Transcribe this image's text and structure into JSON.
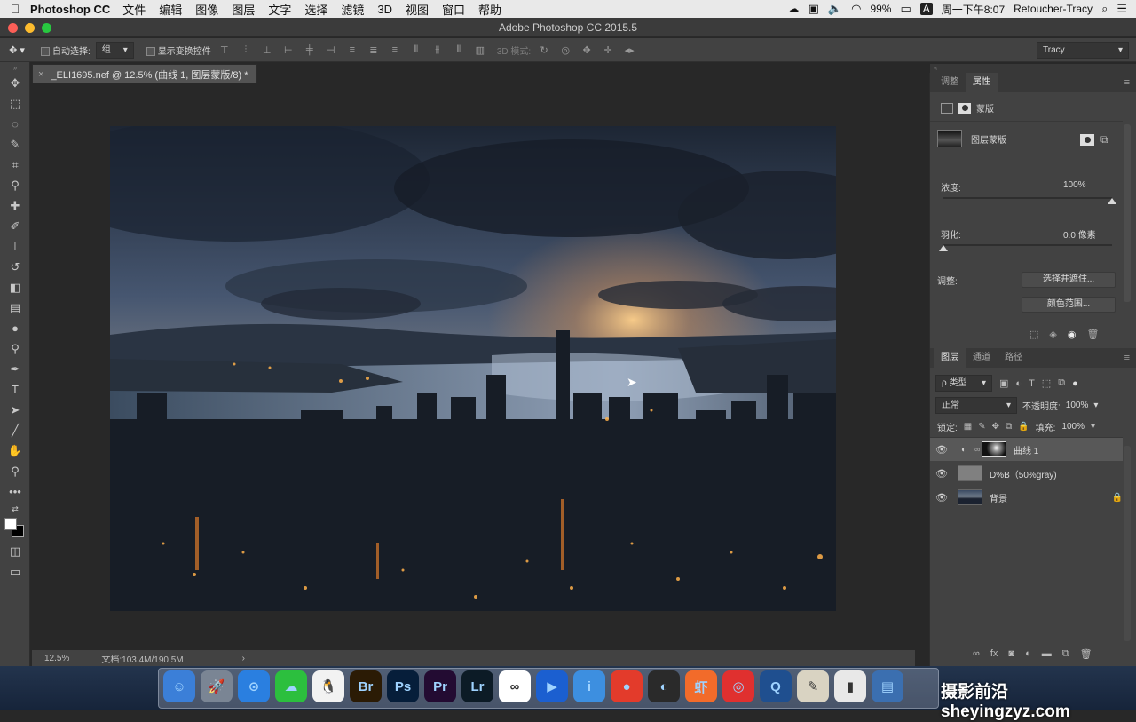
{
  "menubar": {
    "apple": "",
    "app_name": "Photoshop CC",
    "items": [
      "文件",
      "编辑",
      "图像",
      "图层",
      "文字",
      "选择",
      "滤镜",
      "3D",
      "视图",
      "窗口",
      "帮助"
    ],
    "battery": "99%",
    "input_method": "A",
    "clock": "周一下午8:07",
    "user": "Retoucher-Tracy"
  },
  "window": {
    "title": "Adobe Photoshop CC 2015.5"
  },
  "options": {
    "auto_select_label": "自动选择:",
    "auto_select_value": "组",
    "show_transform_label": "显示变换控件",
    "mode_3d_label": "3D 模式:",
    "workspace": "Tracy"
  },
  "document": {
    "tab_title": "_ELI1695.nef @ 12.5% (曲线 1, 图层蒙版/8) *",
    "close_glyph": "×",
    "zoom": "12.5%",
    "doc_size": "文档:103.4M/190.5M",
    "arrow": "›"
  },
  "properties": {
    "tabs": [
      "调整",
      "属性"
    ],
    "header_label": "蒙版",
    "mask_label": "图层蒙版",
    "density_label": "浓度:",
    "density_value": "100%",
    "density": 1.0,
    "feather_label": "羽化:",
    "feather_value": "0.0 像素",
    "feather": 0.0,
    "refine_label": "调整:",
    "refine_button": "选择并遮住...",
    "color_range_button": "颜色范围..."
  },
  "layers": {
    "tabs": [
      "图层",
      "通道",
      "路径"
    ],
    "filter_label": "ρ 类型",
    "blend_mode": "正常",
    "opacity_label": "不透明度:",
    "opacity_value": "100%",
    "lock_label": "锁定:",
    "fill_label": "填充:",
    "fill_value": "100%",
    "items": [
      {
        "name": "曲线 1"
      },
      {
        "name": "D%B（50%gray)"
      },
      {
        "name": "背景"
      }
    ]
  },
  "dock": {
    "apps": [
      {
        "label": "☺",
        "color": "#3b7fd8"
      },
      {
        "label": "🚀",
        "color": "#7a8594"
      },
      {
        "label": "⊙",
        "color": "#2a7fe0"
      },
      {
        "label": "☁",
        "color": "#2cbf3e"
      },
      {
        "label": "🐧",
        "color": "#f2f2f2"
      },
      {
        "label": "Br",
        "color": "#2b1b05"
      },
      {
        "label": "Ps",
        "color": "#061e3a"
      },
      {
        "label": "Pr",
        "color": "#230b32"
      },
      {
        "label": "Lr",
        "color": "#0c1b26"
      },
      {
        "label": "∞",
        "color": "#ffffff"
      },
      {
        "label": "▶",
        "color": "#1b5fd0"
      },
      {
        "label": "i",
        "color": "#3d8fe0"
      },
      {
        "label": "●",
        "color": "#e33b2b"
      },
      {
        "label": "◐",
        "color": "#2a2a2a"
      },
      {
        "label": "虾",
        "color": "#f26b2a"
      },
      {
        "label": "◎",
        "color": "#e0302f"
      },
      {
        "label": "Q",
        "color": "#1f4f8f"
      },
      {
        "label": "✎",
        "color": "#d9d3c2"
      },
      {
        "label": "▮",
        "color": "#e8e8e8"
      },
      {
        "label": "▤",
        "color": "#3b6fb0"
      }
    ]
  },
  "watermark": "摄影前沿 sheyingzyz.com",
  "colors": {
    "accent": "#2f80ed",
    "panel": "#424242",
    "canvas": "#282828"
  }
}
